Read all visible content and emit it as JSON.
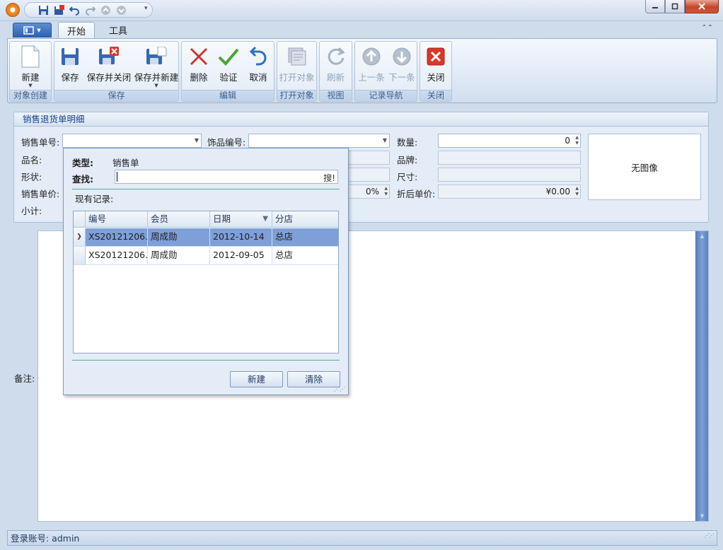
{
  "ribbon": {
    "tabs": [
      {
        "label": "开始"
      },
      {
        "label": "工具"
      }
    ],
    "groups": [
      {
        "label": "对象创建",
        "buttons": [
          {
            "label": "新建"
          }
        ]
      },
      {
        "label": "保存",
        "buttons": [
          {
            "label": "保存"
          },
          {
            "label": "保存并关闭"
          },
          {
            "label": "保存并新建"
          }
        ]
      },
      {
        "label": "编辑",
        "buttons": [
          {
            "label": "删除"
          },
          {
            "label": "验证"
          },
          {
            "label": "取消"
          }
        ]
      },
      {
        "label": "打开对象",
        "buttons": [
          {
            "label": "打开对象"
          }
        ]
      },
      {
        "label": "视图",
        "buttons": [
          {
            "label": "刷新"
          }
        ]
      },
      {
        "label": "记录导航",
        "buttons": [
          {
            "label": "上一条"
          },
          {
            "label": "下一条"
          }
        ]
      },
      {
        "label": "关闭",
        "buttons": [
          {
            "label": "关闭"
          }
        ]
      }
    ]
  },
  "detail": {
    "title": "销售退货单明细",
    "sales_no_label": "销售单号:",
    "item_code_label": "饰品编号:",
    "qty_label": "数量:",
    "qty_value": "0",
    "name_label": "品名:",
    "brand_label": "品牌:",
    "shape_label": "形状:",
    "size_label": "尺寸:",
    "unit_price_label": "销售单价:",
    "discount_value": "0%",
    "discount_price_label": "折后单价:",
    "discount_price_value": "¥0.00",
    "subtotal_label": "小计:",
    "no_image": "无图像",
    "remarks_label": "备注:"
  },
  "popup": {
    "type_label": "类型:",
    "type_value": "销售单",
    "search_label": "查找:",
    "search_button": "搜!",
    "records_label": "现有记录:",
    "columns": [
      "编号",
      "会员",
      "日期",
      "分店"
    ],
    "rows": [
      {
        "no": "XS20121206...",
        "member": "周成勋",
        "date": "2012-10-14",
        "store": "总店"
      },
      {
        "no": "XS20121206...",
        "member": "周成勋",
        "date": "2012-09-05",
        "store": "总店"
      }
    ],
    "new_button": "新建",
    "clear_button": "清除"
  },
  "status": {
    "text": "登录账号: admin"
  }
}
